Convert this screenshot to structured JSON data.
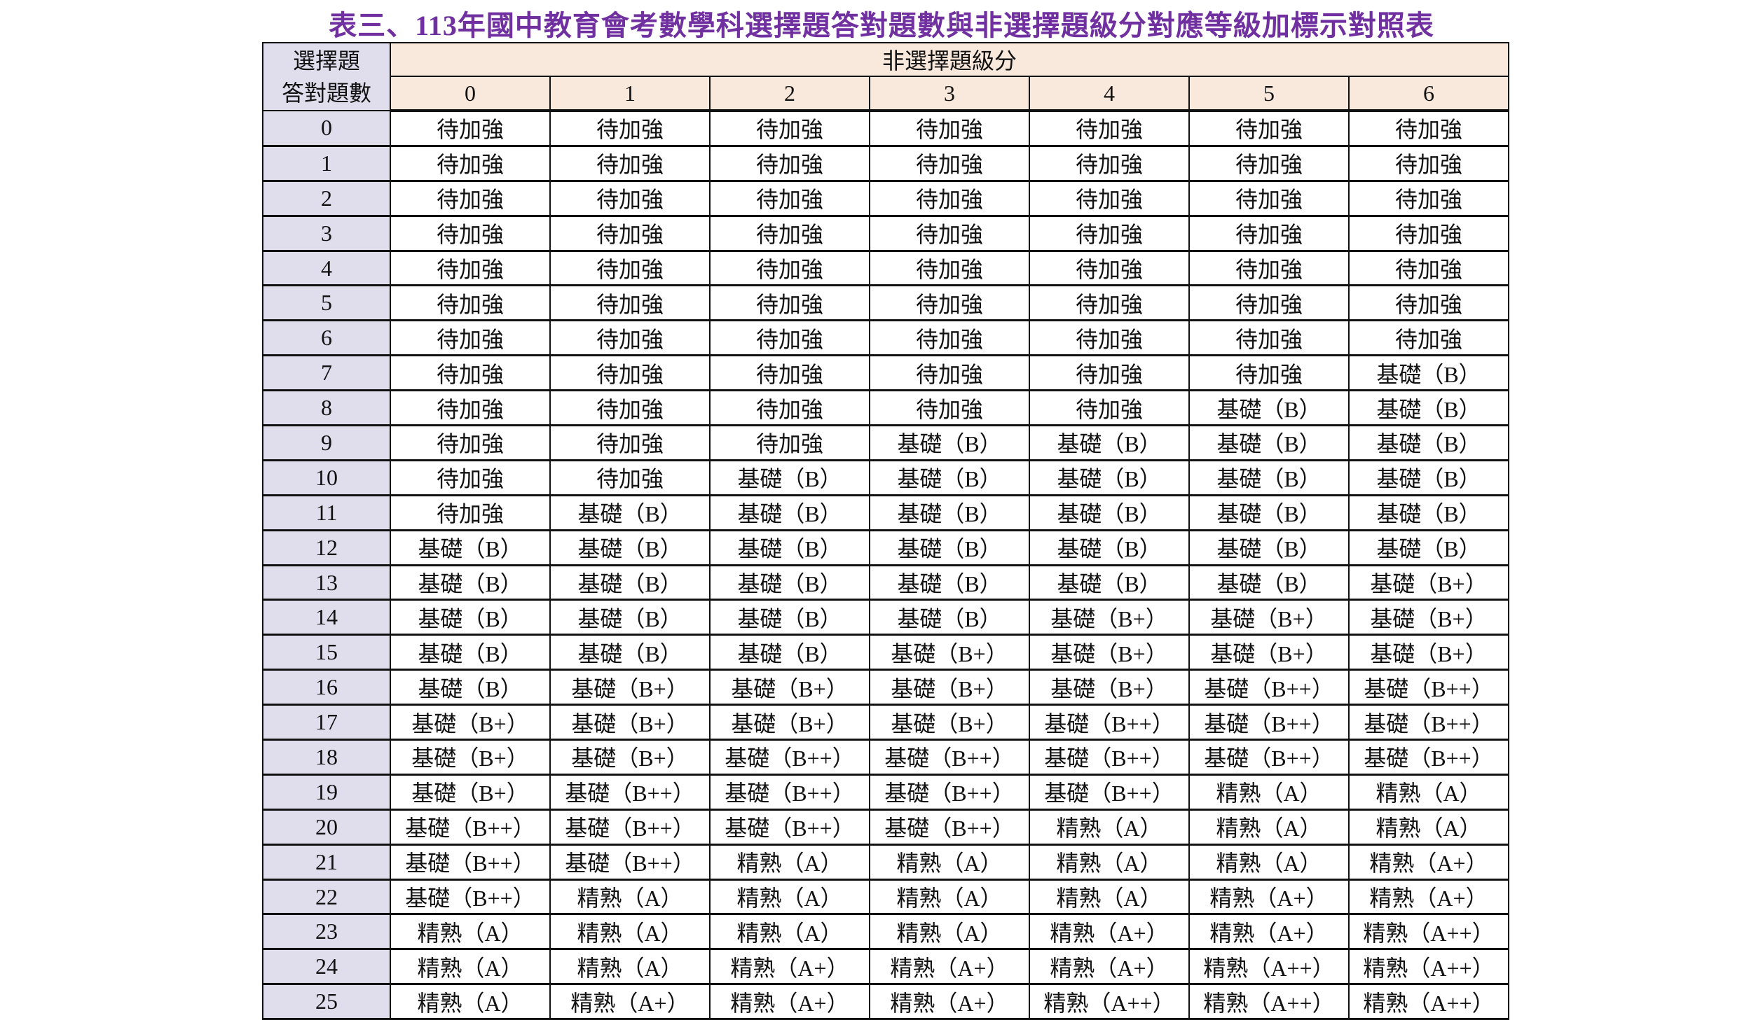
{
  "title": "表三、113年國中教育會考數學科選擇題答對題數與非選擇題級分對應等級加標示對照表",
  "table": {
    "corner_line1": "選擇題",
    "corner_line2": "答對題數",
    "group_header": "非選擇題級分",
    "columns": [
      "0",
      "1",
      "2",
      "3",
      "4",
      "5",
      "6"
    ],
    "colors": {
      "header_bg": "#f9e8dc",
      "row_header_bg": "#e0dded",
      "title": "#7030a0"
    },
    "rows": [
      {
        "label": "0",
        "cells": [
          "待加強",
          "待加強",
          "待加強",
          "待加強",
          "待加強",
          "待加強",
          "待加強"
        ]
      },
      {
        "label": "1",
        "cells": [
          "待加強",
          "待加強",
          "待加強",
          "待加強",
          "待加強",
          "待加強",
          "待加強"
        ]
      },
      {
        "label": "2",
        "cells": [
          "待加強",
          "待加強",
          "待加強",
          "待加強",
          "待加強",
          "待加強",
          "待加強"
        ]
      },
      {
        "label": "3",
        "cells": [
          "待加強",
          "待加強",
          "待加強",
          "待加強",
          "待加強",
          "待加強",
          "待加強"
        ]
      },
      {
        "label": "4",
        "cells": [
          "待加強",
          "待加強",
          "待加強",
          "待加強",
          "待加強",
          "待加強",
          "待加強"
        ]
      },
      {
        "label": "5",
        "cells": [
          "待加強",
          "待加強",
          "待加強",
          "待加強",
          "待加強",
          "待加強",
          "待加強"
        ]
      },
      {
        "label": "6",
        "cells": [
          "待加強",
          "待加強",
          "待加強",
          "待加強",
          "待加強",
          "待加強",
          "待加強"
        ]
      },
      {
        "label": "7",
        "cells": [
          "待加強",
          "待加強",
          "待加強",
          "待加強",
          "待加強",
          "待加強",
          "基礎（B）"
        ]
      },
      {
        "label": "8",
        "cells": [
          "待加強",
          "待加強",
          "待加強",
          "待加強",
          "待加強",
          "基礎（B）",
          "基礎（B）"
        ]
      },
      {
        "label": "9",
        "cells": [
          "待加強",
          "待加強",
          "待加強",
          "基礎（B）",
          "基礎（B）",
          "基礎（B）",
          "基礎（B）"
        ]
      },
      {
        "label": "10",
        "cells": [
          "待加強",
          "待加強",
          "基礎（B）",
          "基礎（B）",
          "基礎（B）",
          "基礎（B）",
          "基礎（B）"
        ]
      },
      {
        "label": "11",
        "cells": [
          "待加強",
          "基礎（B）",
          "基礎（B）",
          "基礎（B）",
          "基礎（B）",
          "基礎（B）",
          "基礎（B）"
        ]
      },
      {
        "label": "12",
        "cells": [
          "基礎（B）",
          "基礎（B）",
          "基礎（B）",
          "基礎（B）",
          "基礎（B）",
          "基礎（B）",
          "基礎（B）"
        ]
      },
      {
        "label": "13",
        "cells": [
          "基礎（B）",
          "基礎（B）",
          "基礎（B）",
          "基礎（B）",
          "基礎（B）",
          "基礎（B）",
          "基礎（B+）"
        ]
      },
      {
        "label": "14",
        "cells": [
          "基礎（B）",
          "基礎（B）",
          "基礎（B）",
          "基礎（B）",
          "基礎（B+）",
          "基礎（B+）",
          "基礎（B+）"
        ]
      },
      {
        "label": "15",
        "cells": [
          "基礎（B）",
          "基礎（B）",
          "基礎（B）",
          "基礎（B+）",
          "基礎（B+）",
          "基礎（B+）",
          "基礎（B+）"
        ]
      },
      {
        "label": "16",
        "cells": [
          "基礎（B）",
          "基礎（B+）",
          "基礎（B+）",
          "基礎（B+）",
          "基礎（B+）",
          "基礎（B++）",
          "基礎（B++）"
        ]
      },
      {
        "label": "17",
        "cells": [
          "基礎（B+）",
          "基礎（B+）",
          "基礎（B+）",
          "基礎（B+）",
          "基礎（B++）",
          "基礎（B++）",
          "基礎（B++）"
        ]
      },
      {
        "label": "18",
        "cells": [
          "基礎（B+）",
          "基礎（B+）",
          "基礎（B++）",
          "基礎（B++）",
          "基礎（B++）",
          "基礎（B++）",
          "基礎（B++）"
        ]
      },
      {
        "label": "19",
        "cells": [
          "基礎（B+）",
          "基礎（B++）",
          "基礎（B++）",
          "基礎（B++）",
          "基礎（B++）",
          "精熟（A）",
          "精熟（A）"
        ]
      },
      {
        "label": "20",
        "cells": [
          "基礎（B++）",
          "基礎（B++）",
          "基礎（B++）",
          "基礎（B++）",
          "精熟（A）",
          "精熟（A）",
          "精熟（A）"
        ]
      },
      {
        "label": "21",
        "cells": [
          "基礎（B++）",
          "基礎（B++）",
          "精熟（A）",
          "精熟（A）",
          "精熟（A）",
          "精熟（A）",
          "精熟（A+）"
        ]
      },
      {
        "label": "22",
        "cells": [
          "基礎（B++）",
          "精熟（A）",
          "精熟（A）",
          "精熟（A）",
          "精熟（A）",
          "精熟（A+）",
          "精熟（A+）"
        ]
      },
      {
        "label": "23",
        "cells": [
          "精熟（A）",
          "精熟（A）",
          "精熟（A）",
          "精熟（A）",
          "精熟（A+）",
          "精熟（A+）",
          "精熟（A++）"
        ]
      },
      {
        "label": "24",
        "cells": [
          "精熟（A）",
          "精熟（A）",
          "精熟（A+）",
          "精熟（A+）",
          "精熟（A+）",
          "精熟（A++）",
          "精熟（A++）"
        ]
      },
      {
        "label": "25",
        "cells": [
          "精熟（A）",
          "精熟（A+）",
          "精熟（A+）",
          "精熟（A+）",
          "精熟（A++）",
          "精熟（A++）",
          "精熟（A++）"
        ]
      }
    ]
  }
}
